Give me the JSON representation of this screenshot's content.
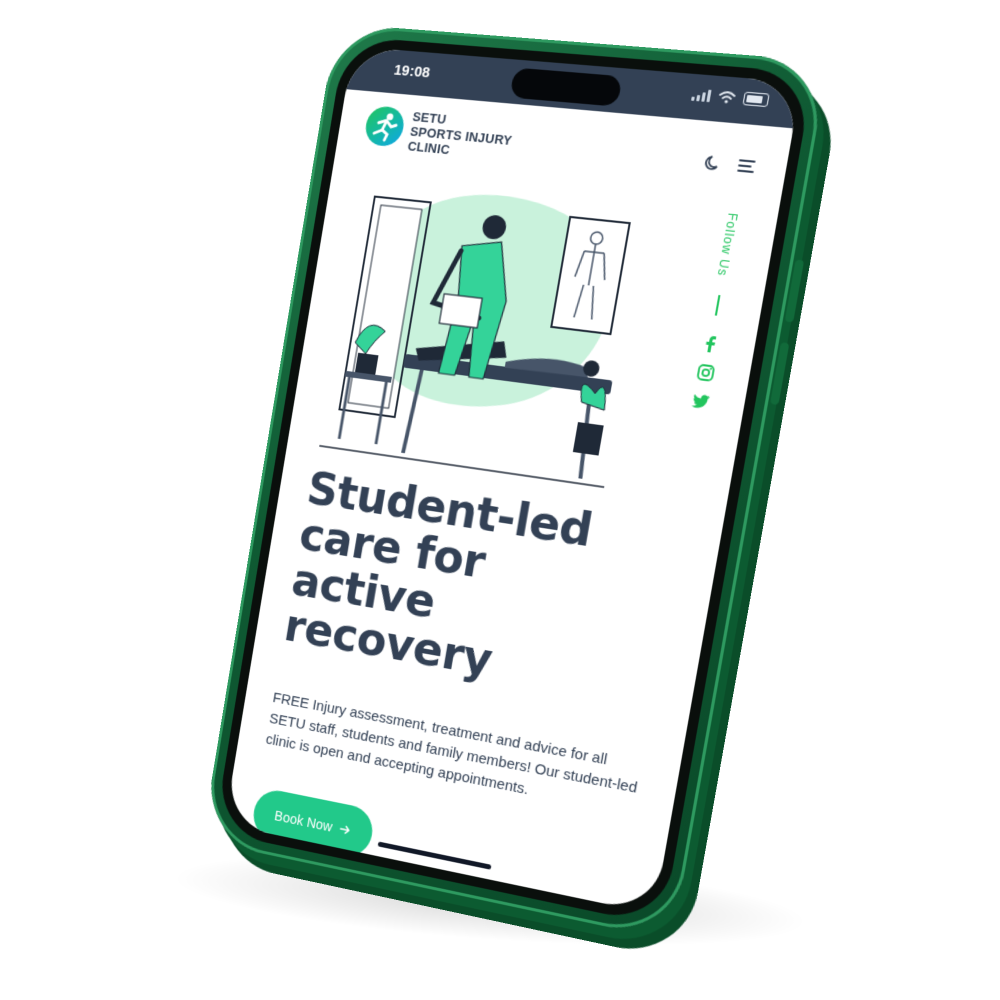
{
  "status_bar": {
    "time": "19:08",
    "icons": [
      "signal-icon",
      "wifi-icon",
      "battery-icon"
    ]
  },
  "header": {
    "logo_lines": [
      "SETU",
      "SPORTS INJURY",
      "CLINIC"
    ],
    "icons": [
      "dark-mode-moon-icon",
      "hamburger-menu-icon"
    ]
  },
  "hero": {
    "illustration": "physiotherapist-treating-patient-illustration",
    "follow_label": "Follow Us",
    "social_icons": [
      "facebook-icon",
      "instagram-icon",
      "twitter-icon"
    ],
    "headline_lines": [
      "Student-led",
      "care for",
      "active",
      "recovery"
    ],
    "intro": "FREE Injury assessment, treatment and advice for all SETU staff, students and family members! Our student-led clinic is open and accepting appointments.",
    "cta_label": "Book Now",
    "cta_icon": "arrow-right-icon"
  },
  "colors": {
    "brand_green": "#22c98a",
    "accent_green": "#22c55e",
    "text_dark": "#334155",
    "phone_body": "#0f5a33",
    "status_bar": "#334155"
  }
}
